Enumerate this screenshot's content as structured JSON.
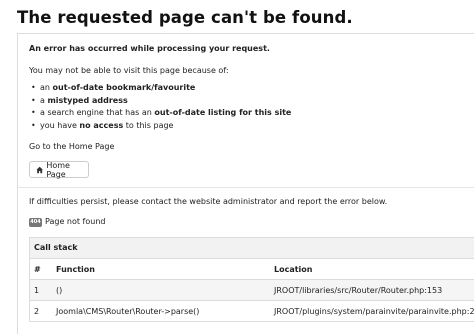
{
  "page_title": "The requested page can't be found.",
  "error_message": "An error has occurred while processing your request.",
  "intro": "You may not be able to visit this page because of:",
  "reasons": [
    [
      {
        "t": "an "
      },
      {
        "t": "out-of-date bookmark/favourite",
        "b": true
      }
    ],
    [
      {
        "t": "a "
      },
      {
        "t": "mistyped address",
        "b": true
      }
    ],
    [
      {
        "t": "a search engine that has an "
      },
      {
        "t": "out-of-date listing for this site",
        "b": true
      }
    ],
    [
      {
        "t": "you have "
      },
      {
        "t": "no access",
        "b": true
      },
      {
        "t": " to this page"
      }
    ]
  ],
  "go_to_home": "Go to the Home Page",
  "home_button": "Home Page",
  "persist_message": "If difficulties persist, please contact the website administrator and report the error below.",
  "error_code": "404",
  "error_text": "Page not found",
  "call_stack": {
    "title": "Call stack",
    "columns": [
      "#",
      "Function",
      "Location"
    ],
    "rows": [
      {
        "num": "1",
        "function": "()",
        "location": "JROOT/libraries/src/Router/Router.php:153"
      },
      {
        "num": "2",
        "function": "Joomla\\CMS\\Router\\Router->parse()",
        "location": "JROOT/plugins/system/parainvite/parainvite.php:25"
      }
    ]
  },
  "icons": {
    "home_button": "home-icon"
  }
}
